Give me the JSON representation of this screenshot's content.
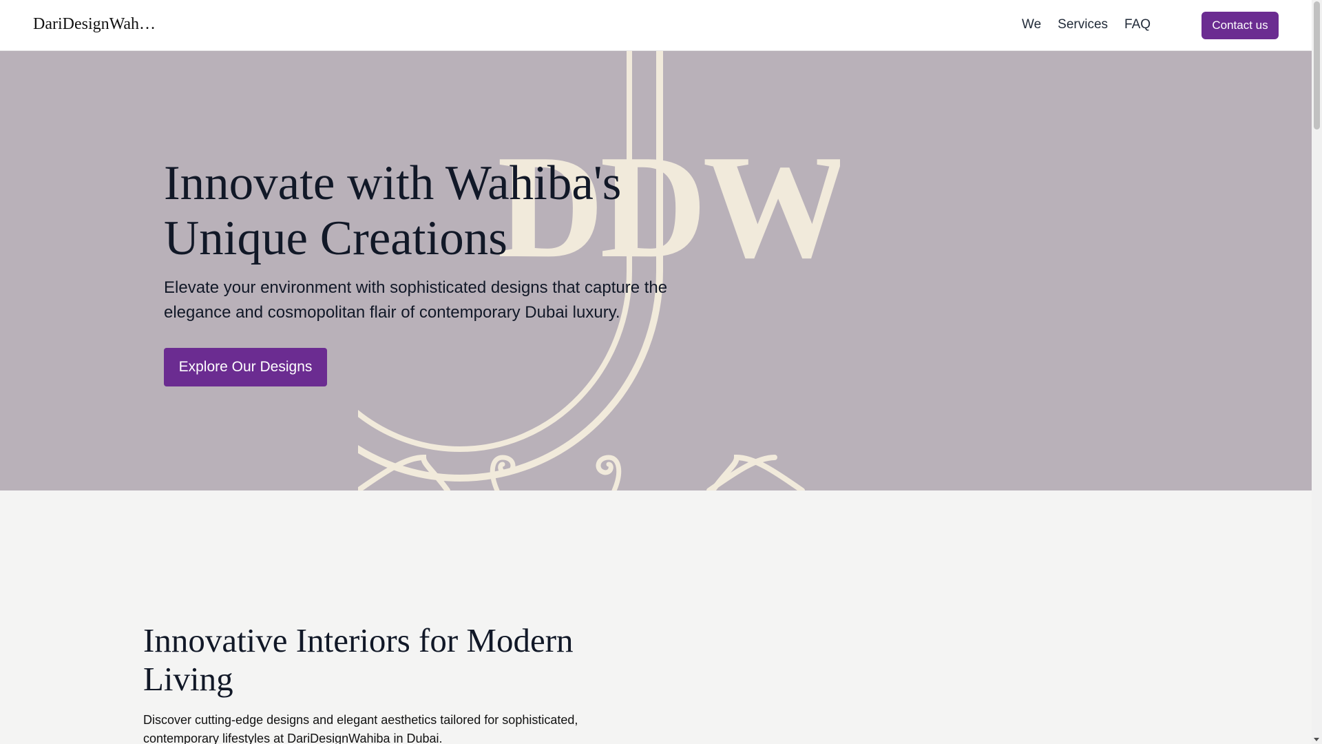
{
  "header": {
    "logo": "DariDesignWahiba",
    "nav": [
      "We",
      "Services",
      "FAQ"
    ],
    "contact_label": "Contact us"
  },
  "hero": {
    "emblem_text": "DDW",
    "title": "Innovate with Wahiba's Unique Creations",
    "subtitle": "Elevate your environment with sophisticated designs that capture the elegance and cosmopolitan flair of contemporary Dubai luxury.",
    "cta_label": "Explore Our Designs",
    "background_color": "#b9b1b9",
    "emblem_color": "#f1eadb"
  },
  "section2": {
    "title": "Innovative Interiors for Modern Living",
    "body": "Discover cutting-edge designs and elegant aesthetics tailored for sophisticated, contemporary lifestyles at DariDesignWahiba in Dubai."
  },
  "colors": {
    "accent": "#6b2c91",
    "text": "#111827"
  },
  "icons": [
    "scroll-down-arrow-icon"
  ]
}
